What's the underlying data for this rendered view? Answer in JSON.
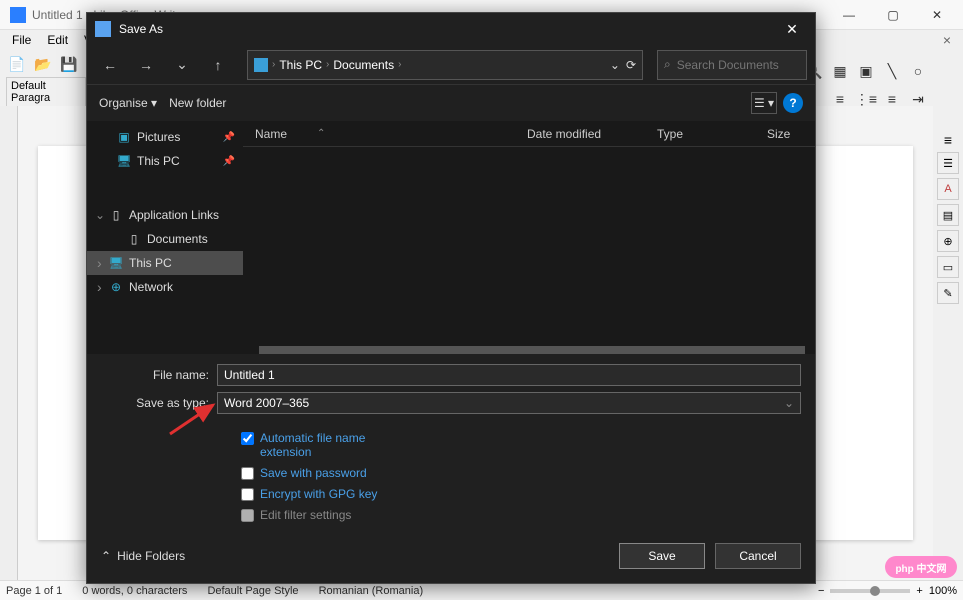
{
  "window": {
    "title": "Untitled 1 - LibreOffice Writer",
    "controls": {
      "min": "—",
      "max": "▢",
      "close": "✕",
      "secondary_close": "×"
    }
  },
  "menu": {
    "file": "File",
    "edit": "Edit",
    "view": "V"
  },
  "paragraph_style": "Default Paragra",
  "statusbar": {
    "page": "Page 1 of 1",
    "words": "0 words, 0 characters",
    "style": "Default Page Style",
    "lang": "Romanian (Romania)",
    "zoom": "100%"
  },
  "watermark": "php 中文网",
  "dialog": {
    "title": "Save As",
    "nav": {
      "back": "←",
      "forward": "→",
      "up": "↑",
      "breadcrumb": {
        "root": "This PC",
        "folder": "Documents"
      },
      "refresh": "⟳",
      "search_placeholder": "Search Documents"
    },
    "toolbar": {
      "organise": "Organise ▾",
      "new_folder": "New folder",
      "help": "?"
    },
    "sidebar": {
      "pictures": "Pictures",
      "this_pc_recent": "This PC",
      "app_links": "Application Links",
      "documents": "Documents",
      "this_pc": "This PC",
      "network": "Network"
    },
    "columns": {
      "name": "Name",
      "date": "Date modified",
      "type": "Type",
      "size": "Size"
    },
    "form": {
      "filename_label": "File name:",
      "filename_value": "Untitled 1",
      "savetype_label": "Save as type:",
      "savetype_value": "Word 2007–365",
      "auto_ext": "Automatic file name extension",
      "save_pwd": "Save with password",
      "encrypt_gpg": "Encrypt with GPG key",
      "edit_filter": "Edit filter settings"
    },
    "footer": {
      "hide_folders": "Hide Folders",
      "save": "Save",
      "cancel": "Cancel"
    }
  }
}
